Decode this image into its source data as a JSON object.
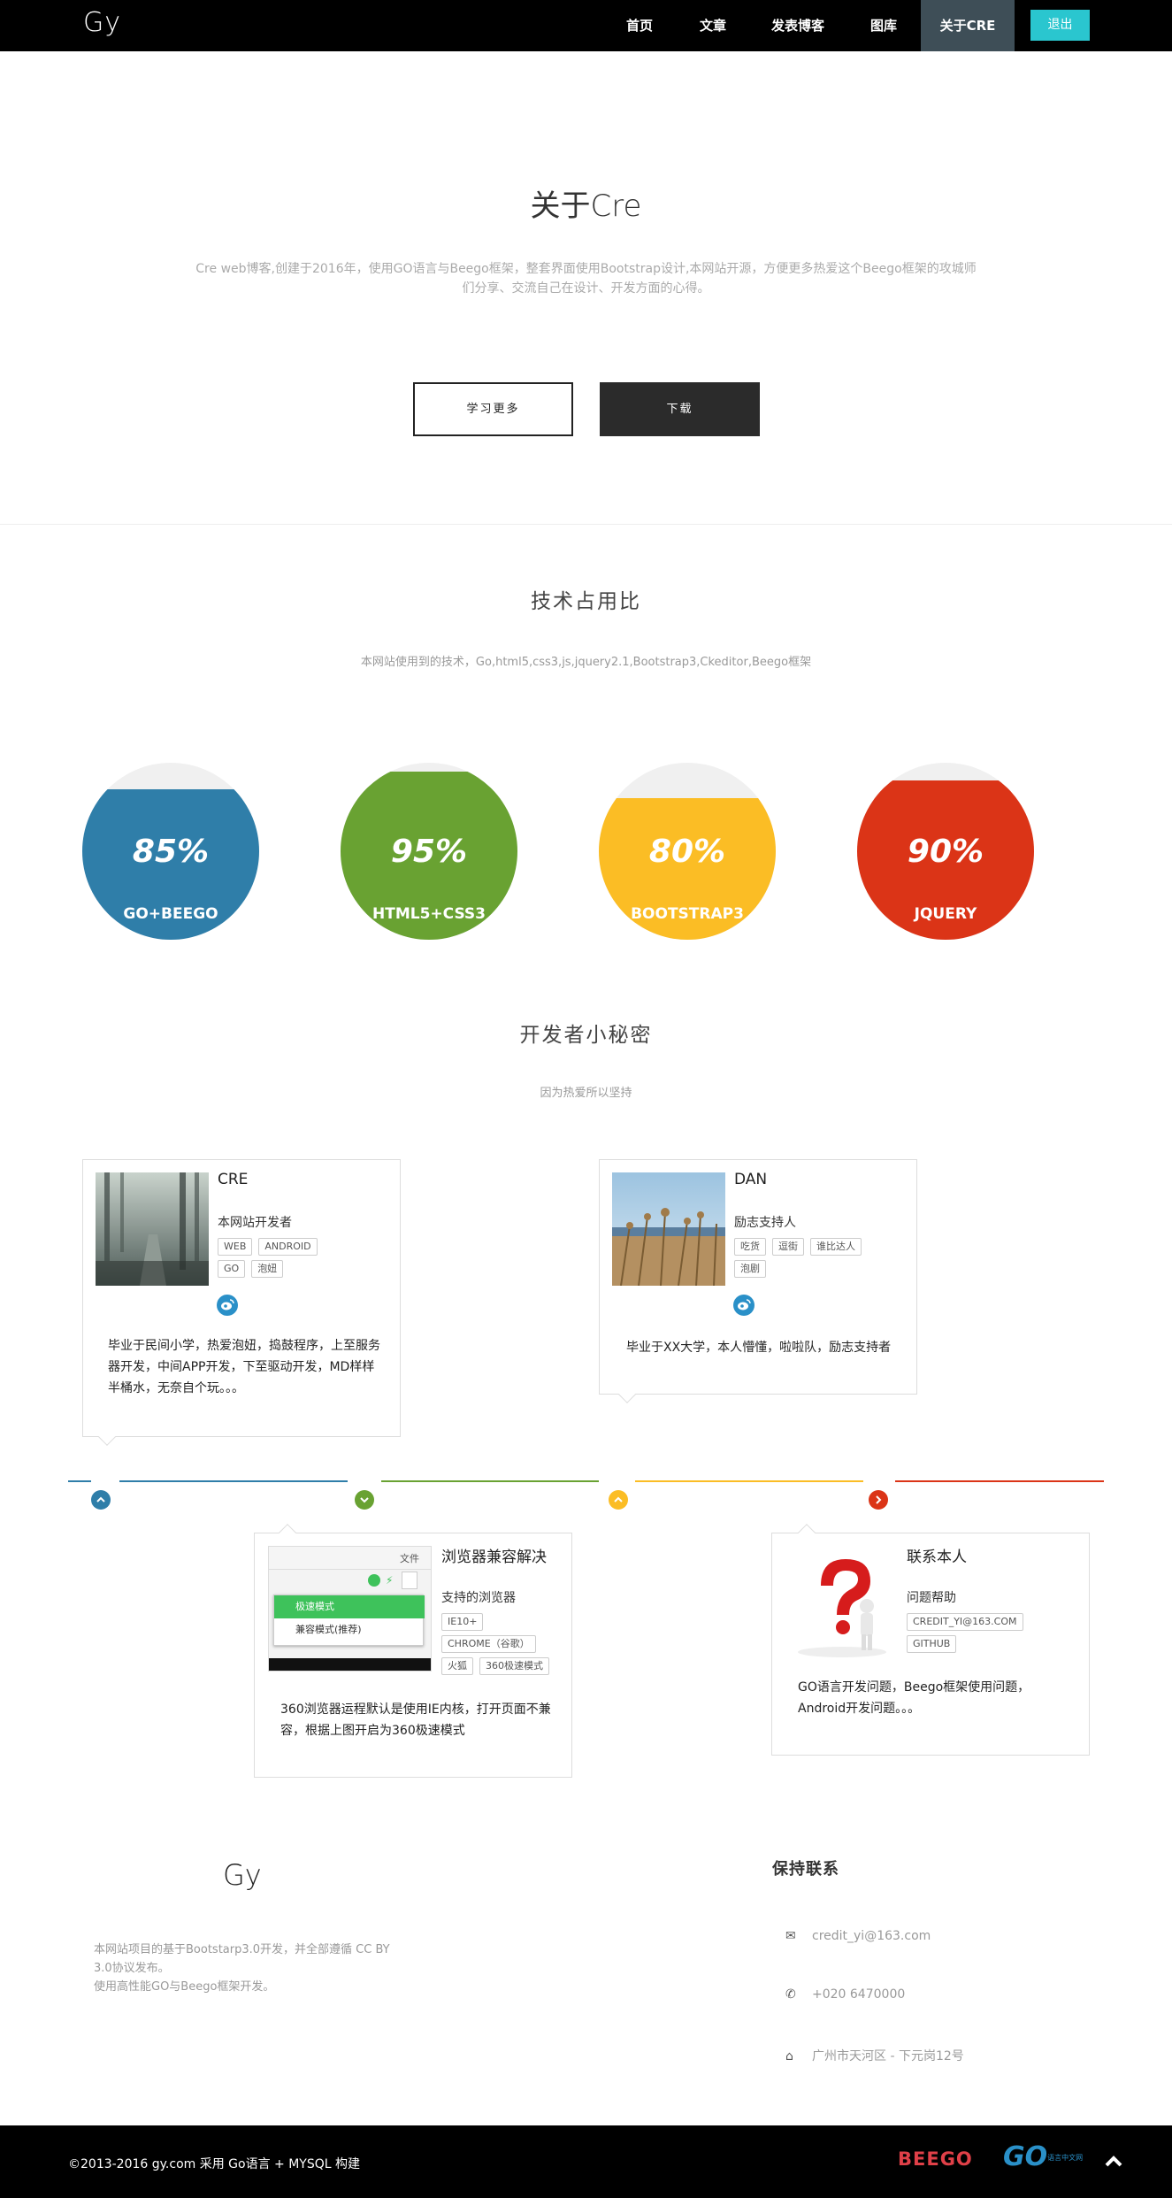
{
  "nav": {
    "brand": "Gy",
    "items": [
      "首页",
      "文章",
      "发表博客",
      "图库",
      "关于CRE"
    ],
    "active_index": 4,
    "logout": "退出"
  },
  "hero": {
    "title": "关于Cre",
    "desc": "Cre web博客,创建于2016年，使用GO语言与Beego框架，整套界面使用Bootstrap设计,本网站开源，方便更多热爱这个Beego框架的攻城师们分享、交流自己在设计、开发方面的心得。",
    "btn_learn": "学习更多",
    "btn_download": "下载"
  },
  "skills": {
    "title": "技术占用比",
    "subtitle": "本网站使用到的技术，Go,html5,css3,js,jquery2.1,Bootstrap3,Ckeditor,Beego框架",
    "items": [
      {
        "pct": "85%",
        "value": 85,
        "name": "GO+BEEGO",
        "color": "#2f7ea9"
      },
      {
        "pct": "95%",
        "value": 95,
        "name": "HTML5+CSS3",
        "color": "#69a232"
      },
      {
        "pct": "80%",
        "value": 80,
        "name": "BOOTSTRAP3",
        "color": "#fbbd25"
      },
      {
        "pct": "90%",
        "value": 90,
        "name": "JQUERY",
        "color": "#db3417"
      }
    ]
  },
  "secrets": {
    "title": "开发者小秘密",
    "subtitle": "因为热爱所以坚持"
  },
  "cards": {
    "cre": {
      "name": "CRE",
      "role": "本网站开发者",
      "tags": [
        "WEB",
        "ANDROID",
        "GO",
        "泡妞"
      ],
      "text": "毕业于民间小学，热爱泡妞，捣鼓程序，上至服务器开发，中间APP开发，下至驱动开发，MD样样半桶水，无奈自个玩。。。"
    },
    "dan": {
      "name": "DAN",
      "role": "励志支持人",
      "tags": [
        "吃货",
        "逗街",
        "谁比达人",
        "泡剧"
      ],
      "text": "毕业于XX大学，本人懵懂，啦啦队，励志支持者"
    },
    "browser": {
      "name": "浏览器兼容解决",
      "role": "支持的浏览器",
      "tags": [
        "IE10+",
        "CHROME（谷歌）",
        "火狐",
        "360极速模式"
      ],
      "text": "360浏览器运程默认是使用IE内核，打开页面不兼容，根据上图开启为360极速模式",
      "shot_menu_top": "文件",
      "shot_opt1": "极速模式",
      "shot_opt2": "兼容模式(推荐)"
    },
    "contact": {
      "name": "联系本人",
      "role": "问题帮助",
      "tags": [
        "CREDIT_YI@163.COM",
        "GITHUB"
      ],
      "text": "GO语言开发问题，Beego框架使用问题，Android开发问题。。。"
    }
  },
  "footer": {
    "brand": "Gy",
    "desc": "本网站项目的基于Bootstarp3.0开发，并全部遵循 CC BY 3.0协议发布。",
    "desc2": "使用高性能GO与Beego框架开发。",
    "contact_title": "保持联系",
    "email": "credit_yi@163.com",
    "phone": "+020 6470000",
    "address": "广州市天河区 - 下元岗12号",
    "copyright": "©2013-2016 gy.com 采用 Go语言 + MYSQL 构建",
    "beego": "BEEGO",
    "go": "GO",
    "go_small": "语言中文网"
  }
}
